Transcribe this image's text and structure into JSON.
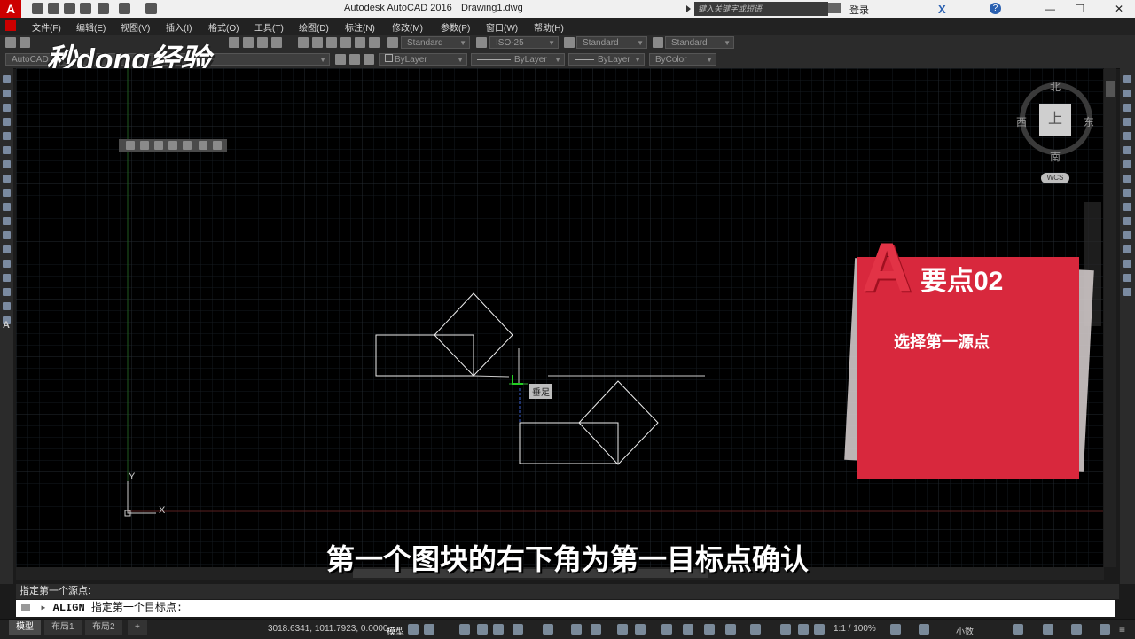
{
  "titlebar": {
    "app_title": "Autodesk AutoCAD 2016",
    "doc_title": "Drawing1.dwg",
    "search_placeholder": "键入关键字或短语",
    "login": "登录"
  },
  "menu": [
    "文件(F)",
    "编辑(E)",
    "视图(V)",
    "插入(I)",
    "格式(O)",
    "工具(T)",
    "绘图(D)",
    "标注(N)",
    "修改(M)",
    "参数(P)",
    "窗口(W)",
    "帮助(H)"
  ],
  "toolbar": {
    "text_style": "Standard",
    "dim_style": "ISO-25",
    "table_style": "Standard",
    "multileader_style": "Standard",
    "workspace": "AutoCAD",
    "color": "ByLayer",
    "linetype": "ByLayer",
    "lineweight": "ByLayer",
    "plotstyle": "ByColor"
  },
  "viewcube": {
    "north": "北",
    "south": "南",
    "east": "东",
    "west": "西",
    "face": "上",
    "wcs": "WCS"
  },
  "ucs": {
    "x": "X",
    "y": "Y"
  },
  "osnap_tooltip": "垂足",
  "card": {
    "title": "要点02",
    "subtitle": "选择第一源点"
  },
  "subtitle": "第一个图块的右下角为第一目标点确认",
  "watermark": "秒dong经验",
  "command": {
    "history": "指定第一个源点:",
    "cmd": "ALIGN",
    "prompt": "指定第一个目标点:"
  },
  "status": {
    "tabs": [
      "模型",
      "布局1",
      "布局2"
    ],
    "add_tab": "+",
    "coords": "3018.6341, 1011.7923, 0.0000",
    "space": "模型",
    "scale": "1:1 / 100%",
    "units": "小数"
  },
  "colors": {
    "accent_red": "#d8283d",
    "canvas": "#000000"
  }
}
